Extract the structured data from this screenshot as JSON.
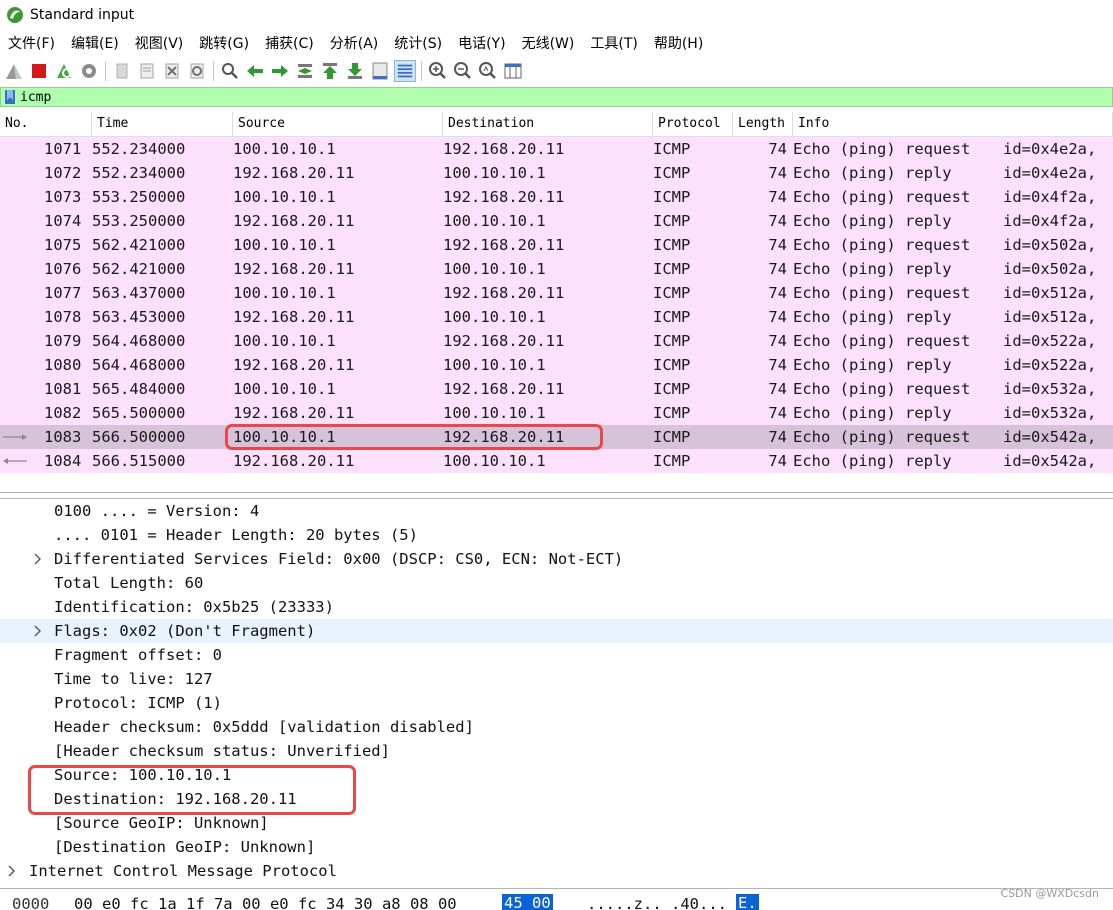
{
  "window": {
    "title": "Standard input"
  },
  "menu": [
    "文件(F)",
    "编辑(E)",
    "视图(V)",
    "跳转(G)",
    "捕获(C)",
    "分析(A)",
    "统计(S)",
    "电话(Y)",
    "无线(W)",
    "工具(T)",
    "帮助(H)"
  ],
  "toolbar": {
    "icons": [
      "shark-fin-start-icon",
      "stop-square-icon",
      "restart-capture-icon",
      "capture-options-gear-icon",
      "open-file-icon",
      "save-file-icon",
      "close-file-icon",
      "reload-icon",
      "find-packet-icon",
      "go-back-arrow-icon",
      "go-forward-arrow-icon",
      "go-to-packet-icon",
      "go-first-icon",
      "go-last-icon",
      "autoscroll-icon",
      "colorize-icon",
      "zoom-in-icon",
      "zoom-out-icon",
      "normal-size-icon",
      "resize-columns-icon"
    ]
  },
  "filter": {
    "value": "icmp"
  },
  "columns": [
    "No.",
    "Time",
    "Source",
    "Destination",
    "Protocol",
    "Length",
    "Info"
  ],
  "packets": [
    {
      "no": "1071",
      "time": "552.234000",
      "src": "100.10.10.1",
      "dst": "192.168.20.11",
      "proto": "ICMP",
      "len": "74",
      "info_type": "Echo (ping) request",
      "info_id": "id=0x4e2a,"
    },
    {
      "no": "1072",
      "time": "552.234000",
      "src": "192.168.20.11",
      "dst": "100.10.10.1",
      "proto": "ICMP",
      "len": "74",
      "info_type": "Echo (ping) reply",
      "info_id": "id=0x4e2a,"
    },
    {
      "no": "1073",
      "time": "553.250000",
      "src": "100.10.10.1",
      "dst": "192.168.20.11",
      "proto": "ICMP",
      "len": "74",
      "info_type": "Echo (ping) request",
      "info_id": "id=0x4f2a,"
    },
    {
      "no": "1074",
      "time": "553.250000",
      "src": "192.168.20.11",
      "dst": "100.10.10.1",
      "proto": "ICMP",
      "len": "74",
      "info_type": "Echo (ping) reply",
      "info_id": "id=0x4f2a,"
    },
    {
      "no": "1075",
      "time": "562.421000",
      "src": "100.10.10.1",
      "dst": "192.168.20.11",
      "proto": "ICMP",
      "len": "74",
      "info_type": "Echo (ping) request",
      "info_id": "id=0x502a,"
    },
    {
      "no": "1076",
      "time": "562.421000",
      "src": "192.168.20.11",
      "dst": "100.10.10.1",
      "proto": "ICMP",
      "len": "74",
      "info_type": "Echo (ping) reply",
      "info_id": "id=0x502a,"
    },
    {
      "no": "1077",
      "time": "563.437000",
      "src": "100.10.10.1",
      "dst": "192.168.20.11",
      "proto": "ICMP",
      "len": "74",
      "info_type": "Echo (ping) request",
      "info_id": "id=0x512a,"
    },
    {
      "no": "1078",
      "time": "563.453000",
      "src": "192.168.20.11",
      "dst": "100.10.10.1",
      "proto": "ICMP",
      "len": "74",
      "info_type": "Echo (ping) reply",
      "info_id": "id=0x512a,"
    },
    {
      "no": "1079",
      "time": "564.468000",
      "src": "100.10.10.1",
      "dst": "192.168.20.11",
      "proto": "ICMP",
      "len": "74",
      "info_type": "Echo (ping) request",
      "info_id": "id=0x522a,"
    },
    {
      "no": "1080",
      "time": "564.468000",
      "src": "192.168.20.11",
      "dst": "100.10.10.1",
      "proto": "ICMP",
      "len": "74",
      "info_type": "Echo (ping) reply",
      "info_id": "id=0x522a,"
    },
    {
      "no": "1081",
      "time": "565.484000",
      "src": "100.10.10.1",
      "dst": "192.168.20.11",
      "proto": "ICMP",
      "len": "74",
      "info_type": "Echo (ping) request",
      "info_id": "id=0x532a,"
    },
    {
      "no": "1082",
      "time": "565.500000",
      "src": "192.168.20.11",
      "dst": "100.10.10.1",
      "proto": "ICMP",
      "len": "74",
      "info_type": "Echo (ping) reply",
      "info_id": "id=0x532a,"
    },
    {
      "no": "1083",
      "time": "566.500000",
      "src": "100.10.10.1",
      "dst": "192.168.20.11",
      "proto": "ICMP",
      "len": "74",
      "info_type": "Echo (ping) request",
      "info_id": "id=0x542a,",
      "selected": true,
      "marker": "request-arrow-icon"
    },
    {
      "no": "1084",
      "time": "566.515000",
      "src": "192.168.20.11",
      "dst": "100.10.10.1",
      "proto": "ICMP",
      "len": "74",
      "info_type": "Echo (ping) reply",
      "info_id": "id=0x542a,",
      "marker": "reply-arrow-icon"
    }
  ],
  "details": [
    {
      "text": "0100 .... = Version: 4",
      "expandable": false
    },
    {
      "text": ".... 0101 = Header Length: 20 bytes (5)",
      "expandable": false
    },
    {
      "text": "Differentiated Services Field: 0x00 (DSCP: CS0, ECN: Not-ECT)",
      "expandable": true
    },
    {
      "text": "Total Length: 60",
      "expandable": false
    },
    {
      "text": "Identification: 0x5b25 (23333)",
      "expandable": false
    },
    {
      "text": "Flags: 0x02 (Don't Fragment)",
      "expandable": true,
      "hover": true
    },
    {
      "text": "Fragment offset: 0",
      "expandable": false
    },
    {
      "text": "Time to live: 127",
      "expandable": false
    },
    {
      "text": "Protocol: ICMP (1)",
      "expandable": false
    },
    {
      "text": "Header checksum: 0x5ddd [validation disabled]",
      "expandable": false
    },
    {
      "text": "[Header checksum status: Unverified]",
      "expandable": false
    },
    {
      "text": "Source: 100.10.10.1",
      "expandable": false
    },
    {
      "text": "Destination: 192.168.20.11",
      "expandable": false
    },
    {
      "text": "[Source GeoIP: Unknown]",
      "expandable": false
    },
    {
      "text": "[Destination GeoIP: Unknown]",
      "expandable": false
    },
    {
      "text": "Internet Control Message Protocol",
      "expandable": true,
      "top": true
    }
  ],
  "bytes": {
    "offset": "0000",
    "hex": "00 e0 fc 1a 1f 7a 00 e0  fc 34 30 a8 08 00",
    "hex_selected": "45 00",
    "ascii": ".....z.. .40...",
    "ascii_selected": "E."
  },
  "watermark": "CSDN @WXDcsdn",
  "colors": {
    "filter_ok": "#afffaf",
    "row_icmp": "#fce0fc",
    "row_selected": "#d7c3d9",
    "highlight_box": "#e84848"
  }
}
